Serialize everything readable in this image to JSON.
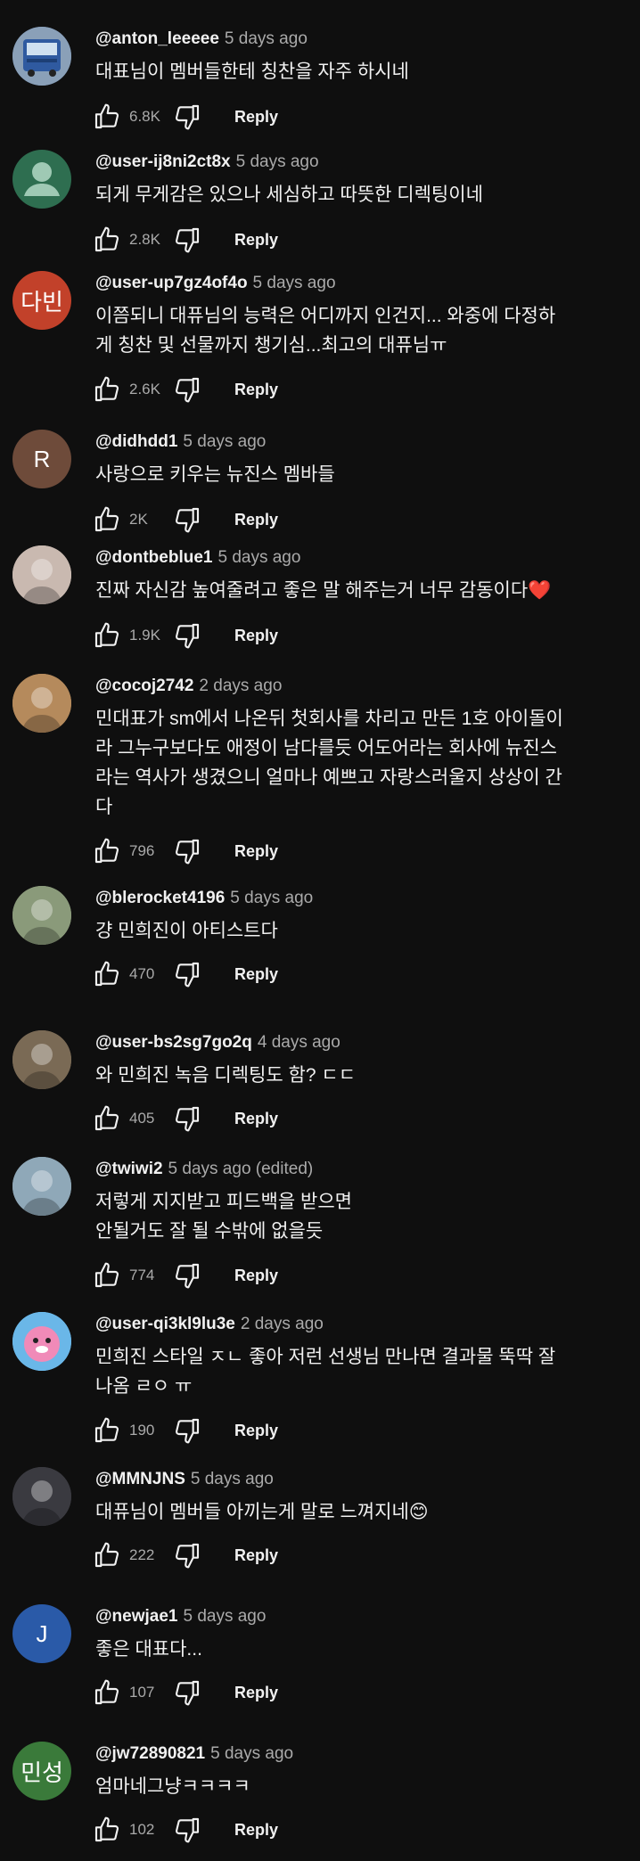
{
  "reply_label": "Reply",
  "comments": [
    {
      "author": "@anton_leeeee",
      "time": "5 days ago",
      "text": "대표님이 멤버들한테 칭찬을 자주 하시네",
      "likes": "6.8K",
      "avatar": {
        "kind": "bus",
        "color": "#4a6fa5"
      }
    },
    {
      "author": "@user-ij8ni2ct8x",
      "time": "5 days ago",
      "text": "되게 무게감은 있으나 세심하고 따뜻한 디렉팅이네",
      "likes": "2.8K",
      "avatar": {
        "kind": "default",
        "color": "#2e6e50"
      }
    },
    {
      "author": "@user-up7gz4of4o",
      "time": "5 days ago",
      "text": "이쯤되니 대퓨님의 능력은 어디까지 인건지... 와중에 다정하\n게 칭찬 및 선물까지 챙기심...최고의 대퓨님ㅠ",
      "likes": "2.6K",
      "avatar": {
        "kind": "letter",
        "letter": "다빈",
        "color": "#c2412a"
      }
    },
    {
      "author": "@didhdd1",
      "time": "5 days ago",
      "text": "사랑으로 키우는 뉴진스 멤바들",
      "likes": "2K",
      "avatar": {
        "kind": "letter",
        "letter": "R",
        "color": "#6e4b3a"
      }
    },
    {
      "author": "@dontbeblue1",
      "time": "5 days ago",
      "text": "진짜 자신감 높여줄려고 좋은 말 해주는거 너무 감동이다❤️",
      "likes": "1.9K",
      "avatar": {
        "kind": "photo",
        "color": "#c9b9b0"
      }
    },
    {
      "author": "@cocoj2742",
      "time": "2 days ago",
      "text": "민대표가 sm에서 나온뒤 첫회사를 차리고 만든 1호 아이돌이\n라 그누구보다도 애정이 남다를듯 어도어라는 회사에 뉴진스\n라는 역사가 생겼으니 얼마나 예쁘고 자랑스러울지 상상이 간\n다",
      "likes": "796",
      "avatar": {
        "kind": "photo",
        "color": "#b58a5c"
      }
    },
    {
      "author": "@blerocket4196",
      "time": "5 days ago",
      "text": "걍 민희진이 아티스트다",
      "likes": "470",
      "avatar": {
        "kind": "photo",
        "color": "#8a9a7a"
      }
    },
    {
      "author": "@user-bs2sg7go2q",
      "time": "4 days ago",
      "text": "와 민희진 녹음 디렉팅도 함? ㄷㄷ",
      "likes": "405",
      "avatar": {
        "kind": "photo",
        "color": "#7a6a55"
      }
    },
    {
      "author": "@twiwi2",
      "time": "5 days ago (edited)",
      "text": "저렇게 지지받고 피드백을 받으면\n안될거도 잘 될 수밖에 없을듯",
      "likes": "774",
      "avatar": {
        "kind": "photo",
        "color": "#8fa8b8"
      }
    },
    {
      "author": "@user-qi3kl9lu3e",
      "time": "2 days ago",
      "text": "민희진 스타일 ㅈㄴ 좋아 저런 선생님 만나면 결과물 뚝딱 잘\n나옴 ㄹㅇ ㅠ",
      "likes": "190",
      "avatar": {
        "kind": "pink",
        "color": "#6ab7e8"
      }
    },
    {
      "author": "@MMNJNS",
      "time": "5 days ago",
      "text": "대퓨님이 멤버들 아끼는게 말로 느껴지네😊",
      "likes": "222",
      "avatar": {
        "kind": "photo",
        "color": "#3a3a40"
      }
    },
    {
      "author": "@newjae1",
      "time": "5 days ago",
      "text": "좋은 대표다...",
      "likes": "107",
      "avatar": {
        "kind": "letter",
        "letter": "J",
        "color": "#2a5aa8"
      }
    },
    {
      "author": "@jw72890821",
      "time": "5 days ago",
      "text": "엄마네그냥ㅋㅋㅋㅋ",
      "likes": "102",
      "avatar": {
        "kind": "letter",
        "letter": "민성",
        "color": "#3a7a3a"
      }
    }
  ]
}
